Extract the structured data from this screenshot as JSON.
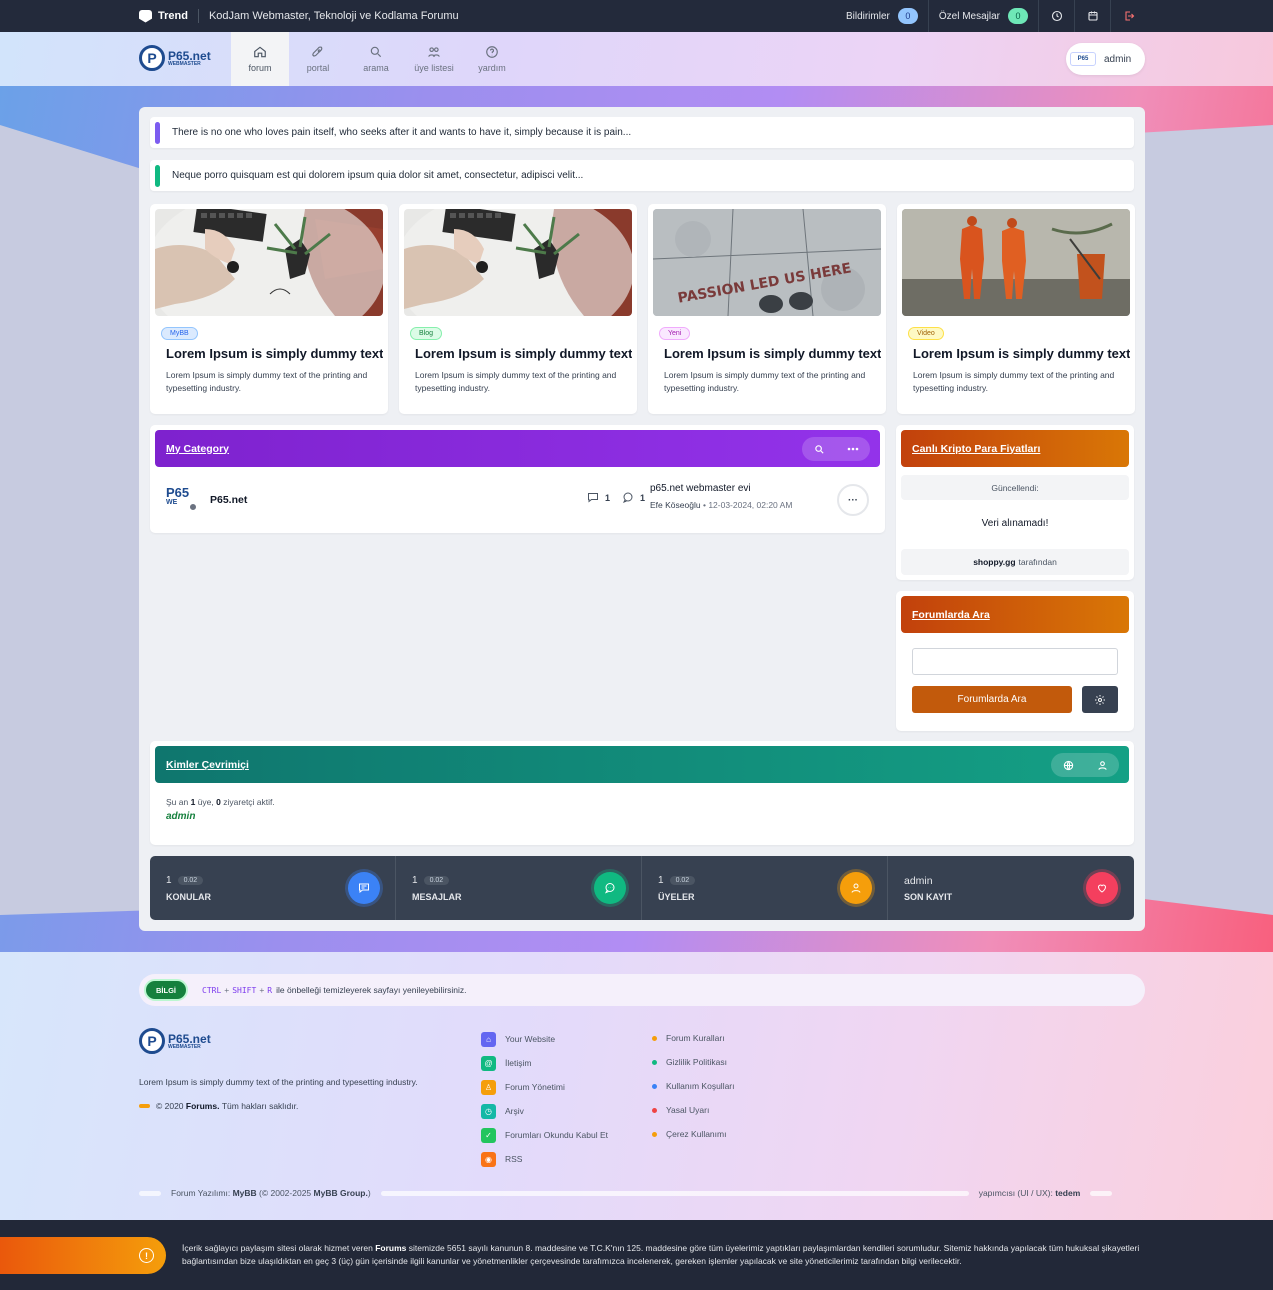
{
  "topbar": {
    "brand": "Trend",
    "site_title": "KodJam Webmaster, Teknoloji ve Kodlama Forumu",
    "notifications_label": "Bildirimler",
    "notifications_count": "0",
    "pm_label": "Özel Mesajlar",
    "pm_count": "0"
  },
  "header": {
    "logo_main": "P65.net",
    "logo_sub": "WEBMASTER",
    "nav": [
      {
        "label": "forum",
        "icon": "home-icon"
      },
      {
        "label": "portal",
        "icon": "rocket-icon"
      },
      {
        "label": "arama",
        "icon": "search-icon"
      },
      {
        "label": "üye listesi",
        "icon": "users-icon"
      },
      {
        "label": "yardım",
        "icon": "help-icon"
      }
    ],
    "user": "admin"
  },
  "announcements": [
    {
      "text": "There is no one who loves pain itself, who seeks after it and wants to have it, simply because it is pain...",
      "color": "#7c5cf0"
    },
    {
      "text": "Neque porro quisquam est qui dolorem ipsum quia dolor sit amet, consectetur, adipisci velit...",
      "color": "#10b981"
    }
  ],
  "cards": [
    {
      "badge": "MyBB",
      "badge_color": "#3b82f6",
      "title": "Lorem Ipsum is simply dummy text of the printing",
      "desc": "Lorem Ipsum is simply dummy text of the printing and typesetting industry."
    },
    {
      "badge": "Blog",
      "badge_color": "#16a34a",
      "title": "Lorem Ipsum is simply dummy text of the printing",
      "desc": "Lorem Ipsum is simply dummy text of the printing and typesetting industry."
    },
    {
      "badge": "Yeni",
      "badge_color": "#c026d3",
      "title": "Lorem Ipsum is simply dummy text of the printing",
      "desc": "Lorem Ipsum is simply dummy text of the printing and typesetting industry."
    },
    {
      "badge": "Video",
      "badge_color": "#ca8a04",
      "title": "Lorem Ipsum is simply dummy text of the printing",
      "desc": "Lorem Ipsum is simply dummy text of the printing and typesetting industry."
    }
  ],
  "card_images": {
    "img3_text": "PASSION LED US HERE"
  },
  "category": {
    "title": "My Category",
    "forum": {
      "logo_main": "P65",
      "logo_sub": "WE",
      "name": "P65.net",
      "threads": "1",
      "posts": "1",
      "last_title": "p65.net webmaster evi",
      "last_user": "Efe Köseoğlu",
      "last_sep": "•",
      "last_date": "12-03-2024, 02:20 AM",
      "more": "···"
    }
  },
  "crypto": {
    "title": "Canlı Kripto Para Fiyatları",
    "updated": "Güncellendi:",
    "message": "Veri alınamadı!",
    "source_brand": "shoppy.gg",
    "source_suffix": "tarafından"
  },
  "search_box": {
    "title": "Forumlarda Ara",
    "input_value": "",
    "button": "Forumlarda Ara"
  },
  "online": {
    "title": "Kimler Çevrimiçi",
    "text_prefix": "Şu an",
    "members": "1",
    "members_suffix": "üye,",
    "guests": "0",
    "guests_suffix": "ziyaretçi aktif.",
    "user": "admin"
  },
  "stats": [
    {
      "num": "1",
      "tag": "0.02",
      "label": "KONULAR",
      "color": "#3b82f6",
      "icon": "comment-icon"
    },
    {
      "num": "1",
      "tag": "0.02",
      "label": "MESAJLAR",
      "color": "#10b981",
      "icon": "chat-icon"
    },
    {
      "num": "1",
      "tag": "0.02",
      "label": "ÜYELER",
      "color": "#f59e0b",
      "icon": "users-icon"
    },
    {
      "num": "admin",
      "tag": "",
      "label": "SON KAYIT",
      "color": "#f43f5e",
      "icon": "heart-icon"
    }
  ],
  "footer": {
    "info_tag": "BİLGİ",
    "keys": [
      "CTRL",
      "SHIFT",
      "R"
    ],
    "info_text": "ile önbelleği temizleyerek sayfayı yenileyebilirsiniz.",
    "logo_main": "P65.net",
    "logo_sub": "WEBMASTER",
    "desc": "Lorem Ipsum is simply dummy text of the printing and typesetting industry.",
    "copy_prefix": "© 2020",
    "copy_brand": "Forums.",
    "copy_suffix": "Tüm hakları saklıdır.",
    "links": [
      {
        "label": "Your Website",
        "color": "#6366f1",
        "icon": "home-icon"
      },
      {
        "label": "İletişim",
        "color": "#10b981",
        "icon": "at-icon"
      },
      {
        "label": "Forum Yönetimi",
        "color": "#f59e0b",
        "icon": "users-icon"
      },
      {
        "label": "Arşiv",
        "color": "#14b8a6",
        "icon": "archive-icon"
      },
      {
        "label": "Forumları Okundu Kabul Et",
        "color": "#22c55e",
        "icon": "check-icon"
      },
      {
        "label": "RSS",
        "color": "#f97316",
        "icon": "rss-icon"
      }
    ],
    "rules": [
      {
        "label": "Forum Kuralları",
        "color": "#f59e0b"
      },
      {
        "label": "Gizlilik Politikası",
        "color": "#10b981"
      },
      {
        "label": "Kullanım Koşulları",
        "color": "#3b82f6"
      },
      {
        "label": "Yasal Uyarı",
        "color": "#ef4444"
      },
      {
        "label": "Çerez Kullanımı",
        "color": "#f59e0b"
      }
    ],
    "powered_prefix": "Forum Yazılımı:",
    "powered_brand": "MyBB",
    "powered_mid": "(© 2002-2025",
    "powered_group": "MyBB Group.",
    "powered_end": ")",
    "design_prefix": "yapımcısı (UI / UX):",
    "design_author": "tedem"
  },
  "legal": {
    "icon": "!",
    "text_a": "İçerik sağlayıcı paylaşım sitesi olarak hizmet veren",
    "brand": "Forums",
    "text_b": "sitemizde 5651 sayılı kanunun 8. maddesine ve T.C.K'nın 125. maddesine göre tüm üyelerimiz yaptıkları paylaşımlardan kendileri sorumludur. Sitemiz hakkında yapılacak tüm hukuksal şikayetleri bağlantısından bize ulaşıldıktan en geç 3 (üç) gün içerisinde ilgili kanunlar ve yönetmenlikler çerçevesinde tarafımızca incelenerek, gereken işlemler yapılacak ve site yöneticilerimiz tarafından bilgi verilecektir."
  }
}
